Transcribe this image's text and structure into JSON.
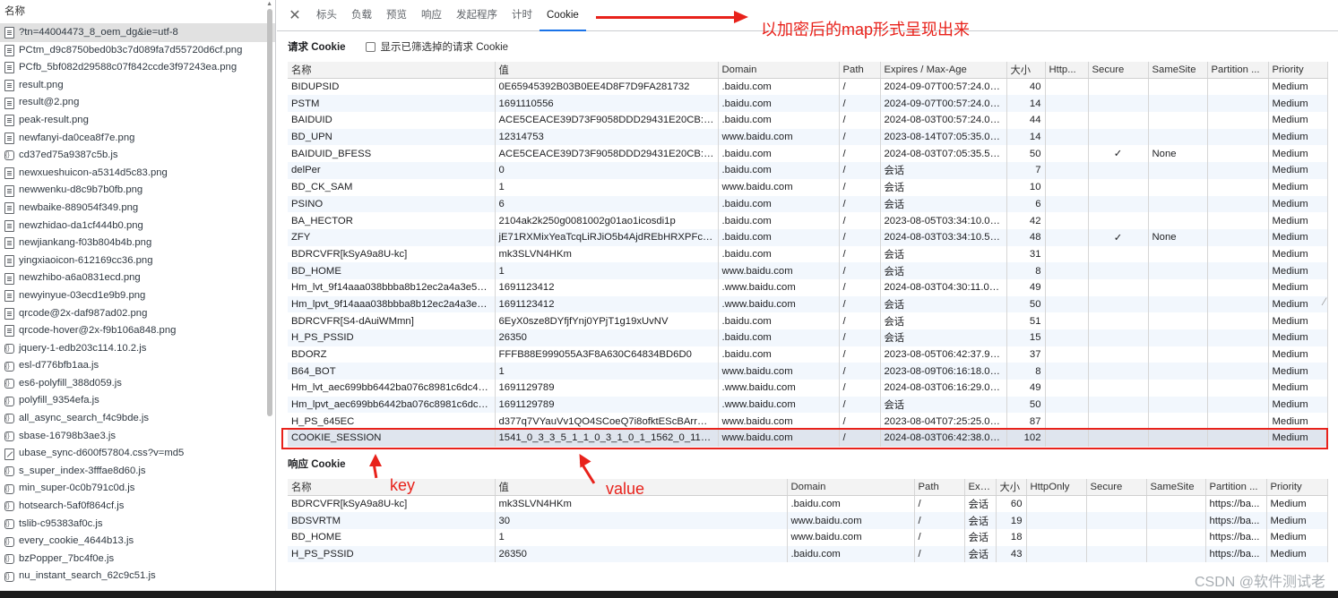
{
  "left_panel": {
    "header": "名称",
    "items": [
      {
        "name": "?tn=44004473_8_oem_dg&ie=utf-8",
        "icon": "doc-icon",
        "selected": true
      },
      {
        "name": "PCtm_d9c8750bed0b3c7d089fa7d55720d6cf.png",
        "icon": "image-icon"
      },
      {
        "name": "PCfb_5bf082d29588c07f842ccde3f97243ea.png",
        "icon": "image-icon"
      },
      {
        "name": "result.png",
        "icon": "image-icon"
      },
      {
        "name": "result@2.png",
        "icon": "image-icon"
      },
      {
        "name": "peak-result.png",
        "icon": "image-icon"
      },
      {
        "name": "newfanyi-da0cea8f7e.png",
        "icon": "image-icon"
      },
      {
        "name": "cd37ed75a9387c5b.js",
        "icon": "js-icon"
      },
      {
        "name": "newxueshuicon-a5314d5c83.png",
        "icon": "image-icon"
      },
      {
        "name": "newwenku-d8c9b7b0fb.png",
        "icon": "image-icon"
      },
      {
        "name": "newbaike-889054f349.png",
        "icon": "image-icon"
      },
      {
        "name": "newzhidao-da1cf444b0.png",
        "icon": "image-icon"
      },
      {
        "name": "newjiankang-f03b804b4b.png",
        "icon": "image-icon"
      },
      {
        "name": "yingxiaoicon-612169cc36.png",
        "icon": "image-icon"
      },
      {
        "name": "newzhibo-a6a0831ecd.png",
        "icon": "image-icon"
      },
      {
        "name": "newyinyue-03ecd1e9b9.png",
        "icon": "image-icon"
      },
      {
        "name": "qrcode@2x-daf987ad02.png",
        "icon": "image-icon"
      },
      {
        "name": "qrcode-hover@2x-f9b106a848.png",
        "icon": "image-icon"
      },
      {
        "name": "jquery-1-edb203c114.10.2.js",
        "icon": "js-icon"
      },
      {
        "name": "esl-d776bfb1aa.js",
        "icon": "js-icon"
      },
      {
        "name": "es6-polyfill_388d059.js",
        "icon": "js-icon"
      },
      {
        "name": "polyfill_9354efa.js",
        "icon": "js-icon"
      },
      {
        "name": "all_async_search_f4c9bde.js",
        "icon": "js-icon"
      },
      {
        "name": "sbase-16798b3ae3.js",
        "icon": "js-icon"
      },
      {
        "name": "ubase_sync-d600f57804.css?v=md5",
        "icon": "css-icon"
      },
      {
        "name": "s_super_index-3fffae8d60.js",
        "icon": "js-icon"
      },
      {
        "name": "min_super-0c0b791c0d.js",
        "icon": "js-icon"
      },
      {
        "name": "hotsearch-5af0f864cf.js",
        "icon": "js-icon"
      },
      {
        "name": "tslib-c95383af0c.js",
        "icon": "js-icon"
      },
      {
        "name": "every_cookie_4644b13.js",
        "icon": "js-icon"
      },
      {
        "name": "bzPopper_7bc4f0e.js",
        "icon": "js-icon"
      },
      {
        "name": "nu_instant_search_62c9c51.js",
        "icon": "js-icon"
      }
    ]
  },
  "tabs": [
    "标头",
    "负载",
    "预览",
    "响应",
    "发起程序",
    "计时",
    "Cookie"
  ],
  "active_tab": "Cookie",
  "annotations": {
    "top": "以加密后的map形式呈现出来",
    "key": "key",
    "value": "value",
    "accent": "#e8221b"
  },
  "request_cookies": {
    "title": "请求 Cookie",
    "checkbox_label": "显示已筛选掉的请求 Cookie",
    "columns": [
      "名称",
      "值",
      "Domain",
      "Path",
      "Expires / Max-Age",
      "大小",
      "Http...",
      "Secure",
      "SameSite",
      "Partition ...",
      "Priority"
    ],
    "rows": [
      [
        "BIDUPSID",
        "0E65945392B03B0EE4D8F7D9FA281732",
        ".baidu.com",
        "/",
        "2024-09-07T00:57:24.007Z",
        "40",
        "",
        "",
        "",
        "",
        "Medium"
      ],
      [
        "PSTM",
        "1691110556",
        ".baidu.com",
        "/",
        "2024-09-07T00:57:24.007Z",
        "14",
        "",
        "",
        "",
        "",
        "Medium"
      ],
      [
        "BAIDUID",
        "ACE5CEACE39D73F9058DDD29431E20CB:FG=1",
        ".baidu.com",
        "/",
        "2024-08-03T00:57:24.007Z",
        "44",
        "",
        "",
        "",
        "",
        "Medium"
      ],
      [
        "BD_UPN",
        "12314753",
        "www.baidu.com",
        "/",
        "2023-08-14T07:05:35.000Z",
        "14",
        "",
        "",
        "",
        "",
        "Medium"
      ],
      [
        "BAIDUID_BFESS",
        "ACE5CEACE39D73F9058DDD29431E20CB:FG=1",
        ".baidu.com",
        "/",
        "2024-08-03T07:05:35.584Z",
        "50",
        "",
        "✓",
        "None",
        "",
        "Medium"
      ],
      [
        "delPer",
        "0",
        ".baidu.com",
        "/",
        "会话",
        "7",
        "",
        "",
        "",
        "",
        "Medium"
      ],
      [
        "BD_CK_SAM",
        "1",
        "www.baidu.com",
        "/",
        "会话",
        "10",
        "",
        "",
        "",
        "",
        "Medium"
      ],
      [
        "PSINO",
        "6",
        ".baidu.com",
        "/",
        "会话",
        "6",
        "",
        "",
        "",
        "",
        "Medium"
      ],
      [
        "BA_HECTOR",
        "2104ak2k250g0081002g01ao1icosdi1p",
        ".baidu.com",
        "/",
        "2023-08-05T03:34:10.000Z",
        "42",
        "",
        "",
        "",
        "",
        "Medium"
      ],
      [
        "ZFY",
        "jE71RXMixYeaTcqLiRJiO5b4AjdREbHRXPFcL9J7...",
        ".baidu.com",
        "/",
        "2024-08-03T03:34:10.585Z",
        "48",
        "",
        "✓",
        "None",
        "",
        "Medium"
      ],
      [
        "BDRCVFR[kSyA9a8U-kc]",
        "mk3SLVN4HKm",
        ".baidu.com",
        "/",
        "会话",
        "31",
        "",
        "",
        "",
        "",
        "Medium"
      ],
      [
        "BD_HOME",
        "1",
        "www.baidu.com",
        "/",
        "会话",
        "8",
        "",
        "",
        "",
        "",
        "Medium"
      ],
      [
        "Hm_lvt_9f14aaa038bbba8b12ec2a4a3e51d...",
        "1691123412",
        ".www.baidu.com",
        "/",
        "2024-08-03T04:30:11.000Z",
        "49",
        "",
        "",
        "",
        "",
        "Medium"
      ],
      [
        "Hm_lpvt_9f14aaa038bbba8b12ec2a4a3e51...",
        "1691123412",
        ".www.baidu.com",
        "/",
        "会话",
        "50",
        "",
        "",
        "",
        "",
        "Medium"
      ],
      [
        "BDRCVFR[S4-dAuiWMmn]",
        "6EyX0sze8DYfjfYnj0YPjT1g19xUvNV",
        ".baidu.com",
        "/",
        "会话",
        "51",
        "",
        "",
        "",
        "",
        "Medium"
      ],
      [
        "H_PS_PSSID",
        "26350",
        ".baidu.com",
        "/",
        "会话",
        "15",
        "",
        "",
        "",
        "",
        "Medium"
      ],
      [
        "BDORZ",
        "FFFB88E999055A3F8A630C64834BD6D0",
        ".baidu.com",
        "/",
        "2023-08-05T06:42:37.976Z",
        "37",
        "",
        "",
        "",
        "",
        "Medium"
      ],
      [
        "B64_BOT",
        "1",
        "www.baidu.com",
        "/",
        "2023-08-09T06:16:18.000Z",
        "8",
        "",
        "",
        "",
        "",
        "Medium"
      ],
      [
        "Hm_lvt_aec699bb6442ba076c8981c6dc490...",
        "1691129789",
        ".www.baidu.com",
        "/",
        "2024-08-03T06:16:29.000Z",
        "49",
        "",
        "",
        "",
        "",
        "Medium"
      ],
      [
        "Hm_lpvt_aec699bb6442ba076c8981c6dc49...",
        "1691129789",
        ".www.baidu.com",
        "/",
        "会话",
        "50",
        "",
        "",
        "",
        "",
        "Medium"
      ],
      [
        "H_PS_645EC",
        "d377q7VYauVv1QO4SCoeQ7i8ofktEScBArrPBu...",
        "www.baidu.com",
        "/",
        "2023-08-04T07:25:25.000Z",
        "87",
        "",
        "",
        "",
        "",
        "Medium"
      ],
      [
        "COOKIE_SESSION",
        "1541_0_3_3_5_1_1_0_3_1_0_1_1562_0_113_0_16...",
        "www.baidu.com",
        "/",
        "2024-08-03T06:42:38.000Z",
        "102",
        "",
        "",
        "",
        "",
        "Medium"
      ]
    ]
  },
  "response_cookies": {
    "title": "响应 Cookie",
    "columns": [
      "名称",
      "值",
      "Domain",
      "Path",
      "Exp...",
      "大小",
      "HttpOnly",
      "Secure",
      "SameSite",
      "Partition ...",
      "Priority"
    ],
    "rows": [
      [
        "BDRCVFR[kSyA9a8U-kc]",
        "mk3SLVN4HKm",
        ".baidu.com",
        "/",
        "会话",
        "60",
        "",
        "",
        "",
        "https://ba...",
        "Medium"
      ],
      [
        "BDSVRTM",
        "30",
        "www.baidu.com",
        "/",
        "会话",
        "19",
        "",
        "",
        "",
        "https://ba...",
        "Medium"
      ],
      [
        "BD_HOME",
        "1",
        "www.baidu.com",
        "/",
        "会话",
        "18",
        "",
        "",
        "",
        "https://ba...",
        "Medium"
      ],
      [
        "H_PS_PSSID",
        "26350",
        ".baidu.com",
        "/",
        "会话",
        "43",
        "",
        "",
        "",
        "https://ba...",
        "Medium"
      ]
    ]
  },
  "watermark": "CSDN @软件测试老"
}
